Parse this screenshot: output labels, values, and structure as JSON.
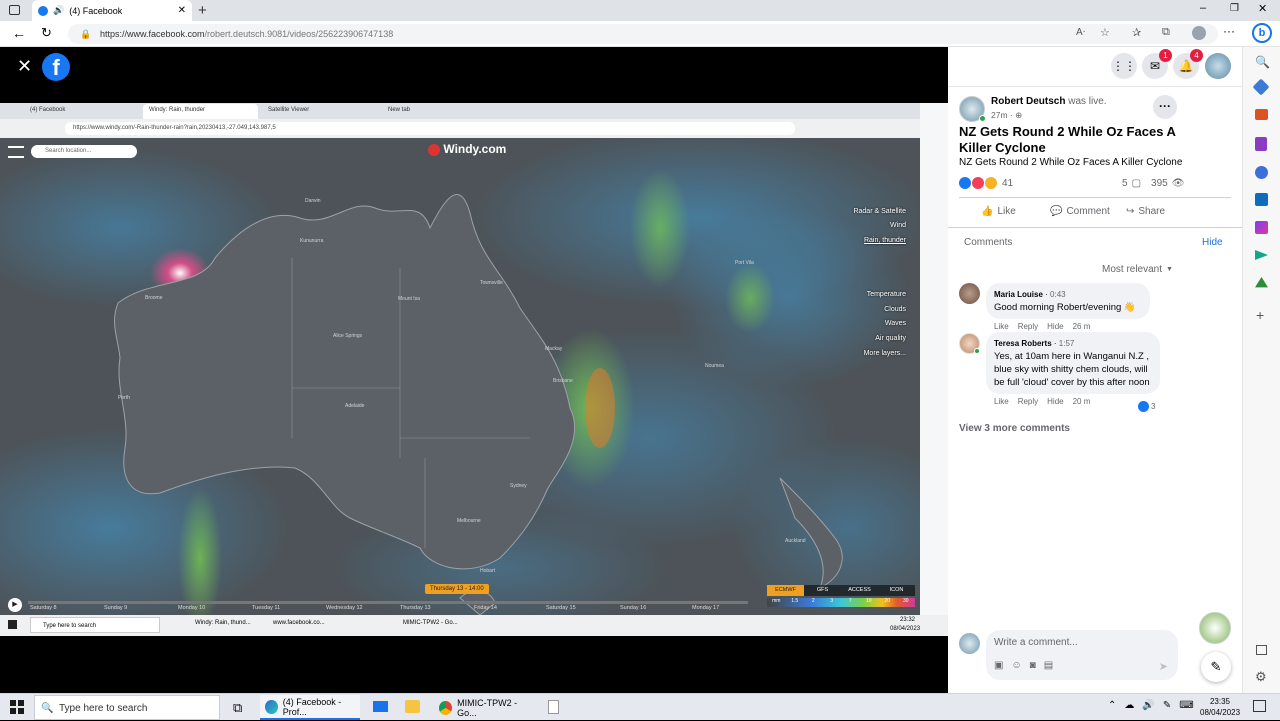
{
  "browser": {
    "tab_title": "(4) Facebook",
    "url_host": "https://www.facebook.com",
    "url_path": "/robert.deutsch.9081/videos/256223906747138"
  },
  "inner_browser": {
    "tabs": [
      "(4) Facebook",
      "Windy: Rain, thunder",
      "Satellite Viewer",
      "New tab"
    ],
    "url": "https://www.windy.com/-Rain-thunder-rain?rain,20230413,-27.049,143.987,5",
    "search_placeholder": "Search location...",
    "logo": "Windy.com",
    "layers": [
      "Radar & Satellite",
      "Wind",
      "Rain, thunder",
      "Temperature",
      "Clouds",
      "Waves",
      "Air quality",
      "More layers..."
    ],
    "timeline_days": [
      "Saturday 8",
      "Sunday 9",
      "Monday 10",
      "Tuesday 11",
      "Wednesday 12",
      "Thursday 13",
      "Friday 14",
      "Saturday 15",
      "Sunday 16",
      "Monday 17"
    ],
    "current_time": "Thursday 13 - 14:00",
    "models": [
      "ECMWF",
      "GFS",
      "ACCESS",
      "ICON"
    ],
    "scale": [
      "mm",
      "1.5",
      "2",
      "3",
      "7",
      "10",
      "20",
      "30"
    ],
    "map_labels": [
      "Darwin",
      "Kununurra",
      "Broome",
      "Mount Isa",
      "Townsville",
      "Mackay",
      "Alice Springs",
      "Brisbane",
      "Perth",
      "Adelaide",
      "Sydney",
      "Melbourne",
      "Hobart",
      "Auckland",
      "Port Vila",
      "Noumea"
    ],
    "taskbar_items": [
      "Type here to search",
      "Windy: Rain, thund...",
      "www.facebook.co...",
      "MIMIC-TPW2 - Go..."
    ],
    "clock_time": "23:32",
    "clock_date": "08/04/2023"
  },
  "post": {
    "author": "Robert Deutsch",
    "was_live": "was live.",
    "time": "27m ·",
    "title": "NZ Gets Round 2 While Oz Faces A Killer Cyclone",
    "subtitle": "NZ Gets Round 2 While Oz Faces A Killer Cyclone",
    "reactions": "41",
    "comments_count": "5",
    "views": "395",
    "like": "Like",
    "comment": "Comment",
    "share": "Share",
    "comments_header": "Comments",
    "hide": "Hide",
    "sort": "Most relevant",
    "comments": [
      {
        "name": "Maria Louise",
        "time": "0:43",
        "text": "Good morning Robert/evening 👋",
        "like": "Like",
        "reply": "Reply",
        "hide": "Hide",
        "age": "26 m"
      },
      {
        "name": "Teresa Roberts",
        "time": "1:57",
        "text": "Yes, at 10am here in Wanganui N.Z , blue sky with shitty chem clouds, will be full 'cloud' cover by this after noon",
        "like": "Like",
        "reply": "Reply",
        "hide": "Hide",
        "age": "20 m",
        "likes": "3"
      }
    ],
    "more_comments": "View 3 more comments",
    "write_placeholder": "Write a comment..."
  },
  "badges": {
    "messenger": "1",
    "notifications": "4"
  },
  "taskbar": {
    "search": "Type here to search",
    "items": [
      "(4) Facebook - Prof...",
      "MIMIC-TPW2 - Go..."
    ],
    "time": "23:35",
    "date": "08/04/2023"
  },
  "colors": {
    "fb_blue": "#1877f2",
    "link_blue": "#216fdb",
    "map_bg": "#4d5358"
  }
}
